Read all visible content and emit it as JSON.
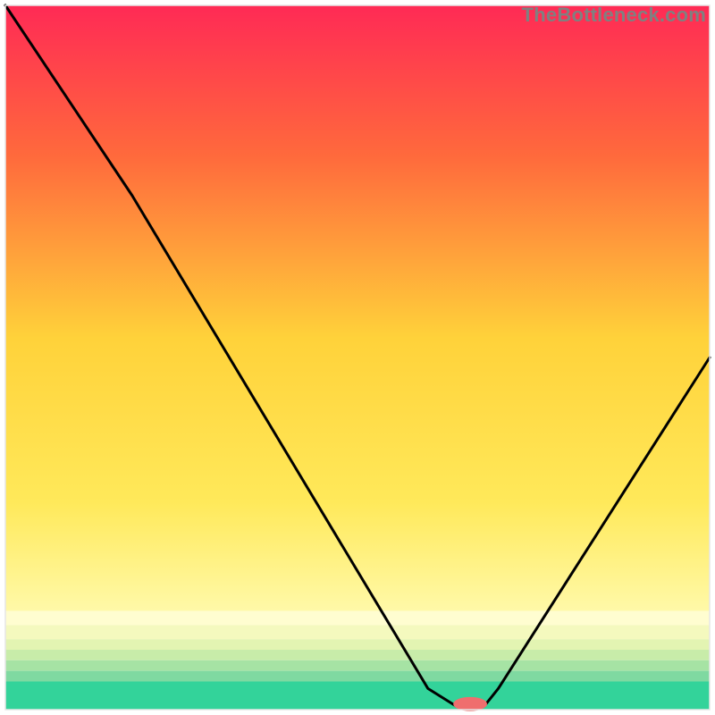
{
  "watermark": "TheBottleneck.com",
  "chart_data": {
    "type": "line",
    "title": "",
    "xlabel": "",
    "ylabel": "",
    "xlim": [
      0,
      100
    ],
    "ylim": [
      0,
      100
    ],
    "grid": false,
    "legend": false,
    "series": [
      {
        "name": "bottleneck-curve",
        "color": "#000000",
        "x": [
          0,
          18,
          60,
          64,
          68,
          70,
          100
        ],
        "y": [
          100,
          73,
          3,
          0.5,
          0.5,
          3,
          50
        ]
      }
    ],
    "marker": {
      "name": "sweet-spot",
      "color": "#ef6e6e",
      "x": 66,
      "y": 0.8,
      "rx": 2.4,
      "ry": 1.0
    },
    "background": {
      "type": "multi-gradient",
      "upper": {
        "y_from": 100,
        "y_to": 14,
        "stops": [
          {
            "offset": 0.0,
            "color": "#ff2a55"
          },
          {
            "offset": 0.25,
            "color": "#ff6a3c"
          },
          {
            "offset": 0.55,
            "color": "#ffd23a"
          },
          {
            "offset": 0.82,
            "color": "#ffe95a"
          },
          {
            "offset": 1.0,
            "color": "#fff9a8"
          }
        ]
      },
      "lower_bands": [
        {
          "y_from": 14.0,
          "y_to": 12.0,
          "color": "#fffdd0"
        },
        {
          "y_from": 12.0,
          "y_to": 10.0,
          "color": "#f4f9be"
        },
        {
          "y_from": 10.0,
          "y_to": 8.5,
          "color": "#e3f4b2"
        },
        {
          "y_from": 8.5,
          "y_to": 7.0,
          "color": "#c8eca9"
        },
        {
          "y_from": 7.0,
          "y_to": 5.5,
          "color": "#a6e3a4"
        },
        {
          "y_from": 5.5,
          "y_to": 4.0,
          "color": "#7fd9a1"
        },
        {
          "y_from": 4.0,
          "y_to": 0.0,
          "color": "#33d39a"
        }
      ]
    },
    "plot_margin": {
      "left": 6,
      "right": 6,
      "top": 6,
      "bottom": 6
    },
    "frame_color": "#e6e6e6"
  }
}
